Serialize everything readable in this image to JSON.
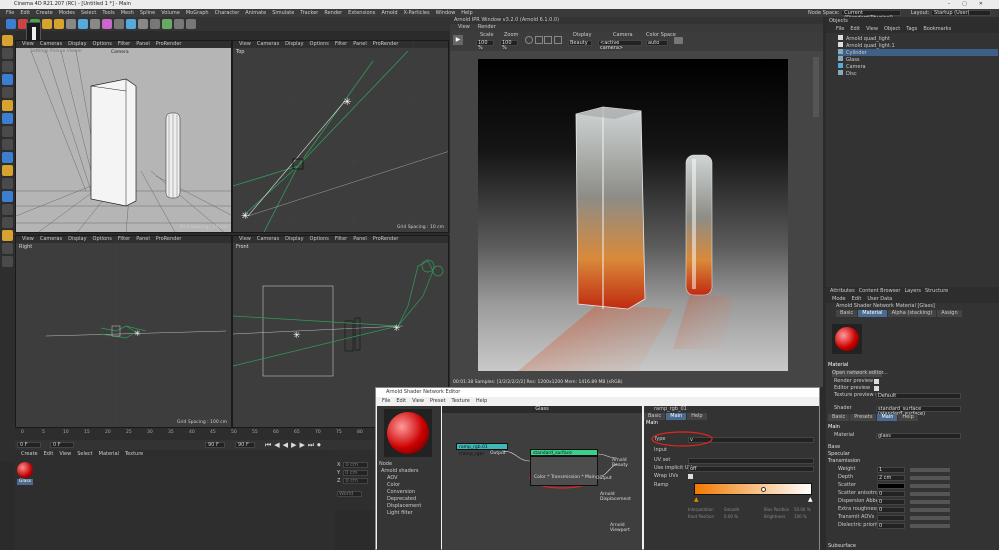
{
  "window": {
    "title": "Cinema 4D R21.207 (RC) - [Untitled 1 *] - Main"
  },
  "menubar": [
    "File",
    "Edit",
    "Create",
    "Modes",
    "Select",
    "Tools",
    "Mesh",
    "Spline",
    "Volume",
    "MoGraph",
    "Character",
    "Animate",
    "Simulate",
    "Tracker",
    "Render",
    "Extensions",
    "Arnold",
    "X-Particles",
    "Window",
    "Help"
  ],
  "node_space": {
    "label": "Node Space:",
    "value": "Current (Standard/Physical)"
  },
  "layout": {
    "label": "Layout:",
    "value": "Startup (User)"
  },
  "viewport_menu": [
    "View",
    "Cameras",
    "Display",
    "Options",
    "Filter",
    "Panel",
    "ProRender"
  ],
  "viewports": {
    "perspective": {
      "camera": "Camera",
      "grid": "Grid Spacing : 10 cm",
      "overlay": "Settings   Picture Viewer"
    },
    "top": {
      "label": "Top",
      "grid": "Grid Spacing : 10 cm"
    },
    "right": {
      "label": "Right",
      "grid": "Grid Spacing : 100 cm"
    },
    "front": {
      "label": "Front",
      "grid": "Grid Spacing : 100 cm"
    }
  },
  "ipr": {
    "title": "Arnold IPR Window v3.2.0 (Arnold 6.1.0.0)",
    "menu": [
      "View",
      "Render"
    ],
    "scale_label": "Scale",
    "scale": "100 %",
    "zoom_label": "Zoom",
    "zoom": "100 %",
    "display_label": "Display",
    "display": "Beauty",
    "camera_label": "Camera",
    "camera": "<active camera>",
    "colorspace_label": "Color Space",
    "colorspace": "auto",
    "status": "00:01:38  Samples: [3/2/2/2/2/2]  Res: 1200x1200  Mem: 1416.89 MB (sRGB)"
  },
  "objects_panel": {
    "tab": "Objects",
    "menu": [
      "File",
      "Edit",
      "View",
      "Object",
      "Tags",
      "Bookmarks"
    ],
    "items": [
      "Arnold quad_light",
      "Arnold quad_light.1",
      "Cylinder",
      "Glass",
      "Camera",
      "Disc"
    ]
  },
  "attributes": {
    "tabs": [
      "Attributes",
      "Content Browser",
      "Layers",
      "Structure"
    ],
    "menu": [
      "Mode",
      "Edit",
      "User Data"
    ],
    "title": "Arnold Shader Network Material [Glass]",
    "subtabs": [
      "Basic",
      "Material",
      "Alpha (stacking)",
      "Assign"
    ],
    "section_material": "Material",
    "open_editor": "Open network editor...",
    "render_preview": "Render preview",
    "editor_preview": "Editor preview",
    "texture_preview_size": "Texture preview size",
    "texture_preview_value": "Default",
    "shader_label": "Shader",
    "shader_value": "standard_surface (standard_surface)",
    "shader_tabs": [
      "Basic",
      "Presets",
      "Main",
      "Help"
    ],
    "main_header": "Main",
    "material_label": "Material",
    "material_value": "glass",
    "sections": [
      "Base",
      "Specular",
      "Transmission"
    ],
    "props": [
      {
        "label": "Weight",
        "value": "1"
      },
      {
        "label": "Depth",
        "value": "2 cm"
      },
      {
        "label": "Scatter",
        "value": ""
      },
      {
        "label": "Scatter anisotropy",
        "value": "0"
      },
      {
        "label": "Dispersion Abbe",
        "value": "0"
      },
      {
        "label": "Extra roughness",
        "value": "0"
      },
      {
        "label": "Transmit AOVs",
        "value": ""
      },
      {
        "label": "Dielectric priority",
        "value": "0"
      }
    ],
    "subsurface": "Subsurface"
  },
  "right_tools": [
    "Ass",
    "Tx",
    "L",
    "?",
    "OP",
    "IPR"
  ],
  "timeline": {
    "ticks": [
      "0",
      "5",
      "10",
      "15",
      "20",
      "25",
      "30",
      "35",
      "40",
      "45",
      "50",
      "55",
      "60",
      "65",
      "70",
      "75",
      "80"
    ],
    "start": "0 F",
    "current": "0 F",
    "end": "90 F",
    "end2": "90 F"
  },
  "materials": {
    "menu": [
      "Create",
      "Edit",
      "View",
      "Select",
      "Material",
      "Texture"
    ],
    "item": "Glass"
  },
  "coords": {
    "rows": [
      "X",
      "Y",
      "Z"
    ],
    "values": [
      "0 cm",
      "0 cm",
      "0 cm"
    ],
    "apply": "World"
  },
  "node_editor": {
    "title": "Arnold Shader Network Editor",
    "menu": [
      "File",
      "Edit",
      "View",
      "Preset",
      "Texture",
      "Help"
    ],
    "canvas_title": "Glass",
    "nodes_label": "Node",
    "tree": [
      "Arnold shaders",
      "AOV",
      "Color",
      "Conversion",
      "Deprecated",
      "Displacement",
      "Light filter"
    ],
    "ramp_node": "ramp_rgb.01 (ramp_rgb)",
    "ramp_out": "Output",
    "ss_node": "standard_surface (standard_surface)",
    "multiply_node": "Color * Transmission * Main",
    "ss_out": "Output",
    "beauty": "Arnold Beauty",
    "displacement": "Arnold Displacement",
    "viewport": "Arnold Viewport",
    "attr_title": "ramp_rgb_01",
    "attr_tabs": [
      "Basic",
      "Main",
      "Help"
    ],
    "main": "Main",
    "type_label": "Type",
    "type_value": "v",
    "input_label": "Input",
    "uvset_label": "UV set",
    "implicit_label": "Use implicit UVs",
    "implicit_value": "off",
    "wrap_label": "Wrap UVs",
    "ramp_label": "Ramp",
    "interp_label": "Interpolation",
    "interp_value": "Smooth",
    "knot_label": "Knot Position",
    "knot_value": "0.00 %",
    "bias_label": "Bias Position",
    "bias_value": "50.00 %",
    "brightness_label": "Brightness",
    "brightness_value": "100 %"
  },
  "hud": {
    "value": "32"
  },
  "colors": {
    "accent": "#4b6a8f",
    "annotation": "#e3261f",
    "ramp_start": "#f07a00",
    "ramp_end": "#ffffff"
  }
}
